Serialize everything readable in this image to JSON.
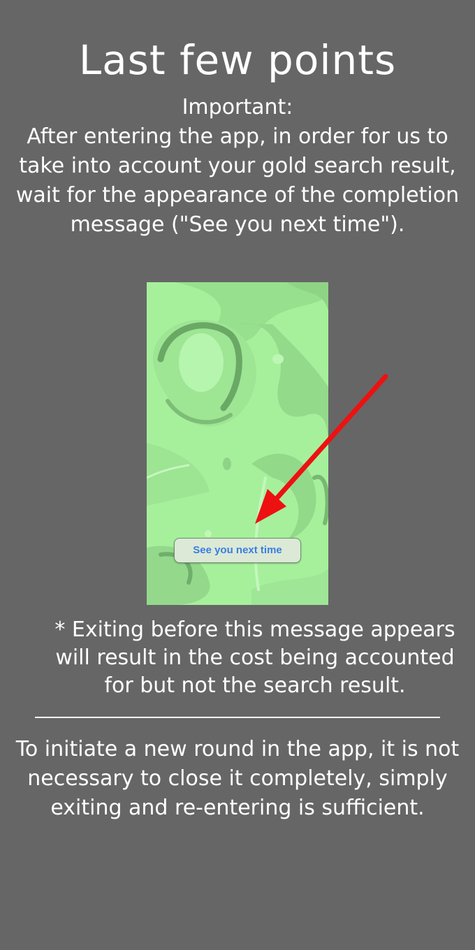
{
  "page": {
    "title": "Last few points",
    "important_label": "Important:",
    "important_text": "After entering the app, in order for us to take into account your gold search result, wait for the appearance of the completion message (\"See you next time\").",
    "preview_button_label": "See you next time",
    "footnote": "* Exiting before this message appears will result in the cost being accounted for but not the search result.",
    "closing_text": "To initiate a new round in the app, it is not necessary to close it completely, simply exiting and re-entering is sufficient."
  },
  "colors": {
    "background": "#666666",
    "text": "#ffffff",
    "preview_green": "#a6f09c",
    "arrow": "#ee1111",
    "button_text": "#3a7ee0"
  },
  "icons": {
    "arrow": "red-arrow-icon"
  }
}
